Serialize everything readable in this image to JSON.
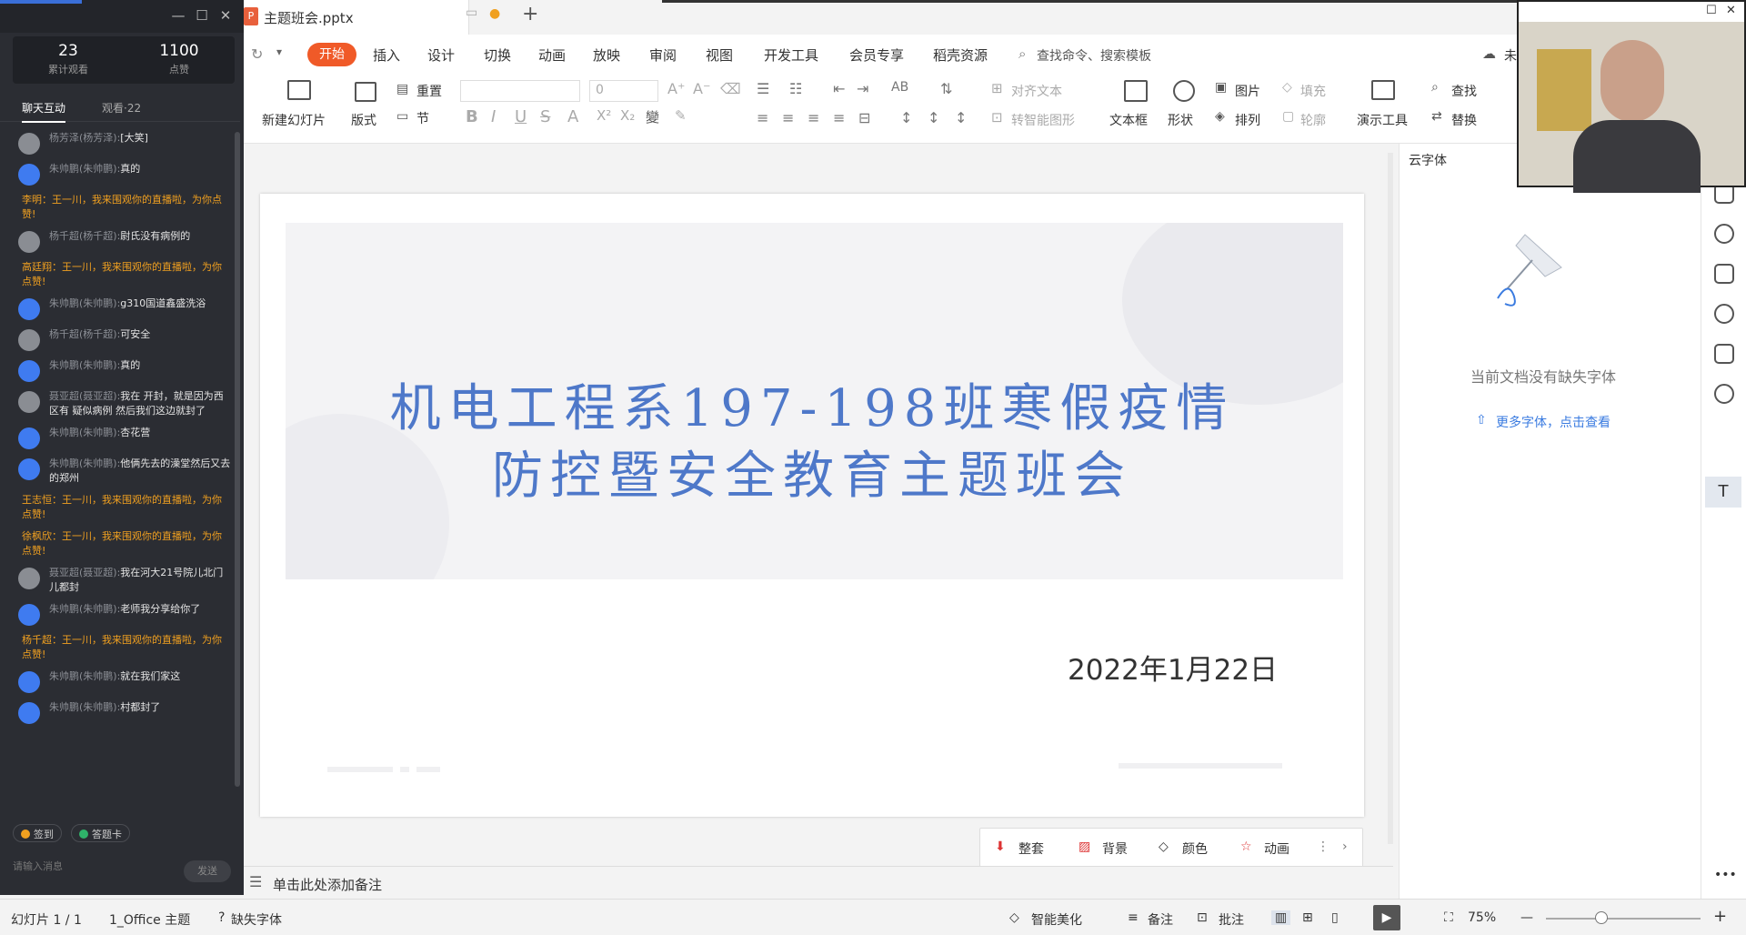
{
  "live": {
    "stats": [
      {
        "num": "23",
        "label": "累计观看"
      },
      {
        "num": "1100",
        "label": "点赞"
      }
    ],
    "tab_chat": "聊天互动",
    "tab_viewers": "观看·22",
    "messages": [
      {
        "kind": "user",
        "avatar": "gray",
        "name": "杨芳泽(杨芳泽):",
        "text": "[大笑]"
      },
      {
        "kind": "user",
        "avatar": "blue",
        "name": "朱帅鹏(朱帅鹏):",
        "text": "真的"
      },
      {
        "kind": "sys",
        "text": "李明：王一川，我来围观你的直播啦，为你点赞!"
      },
      {
        "kind": "user",
        "avatar": "gray",
        "name": "杨千超(杨千超):",
        "text": "尉氏没有病例的"
      },
      {
        "kind": "sys",
        "text": "高廷翔：王一川，我来围观你的直播啦，为你点赞!"
      },
      {
        "kind": "user",
        "avatar": "blue",
        "name": "朱帅鹏(朱帅鹏):",
        "text": "g310国道鑫盛洗浴"
      },
      {
        "kind": "user",
        "avatar": "gray",
        "name": "杨千超(杨千超):",
        "text": "可安全"
      },
      {
        "kind": "user",
        "avatar": "blue",
        "name": "朱帅鹏(朱帅鹏):",
        "text": "真的"
      },
      {
        "kind": "user",
        "avatar": "gray",
        "name": "聂亚超(聂亚超):",
        "text": "我在 开封，就是因为西区有 疑似病例 然后我们这边就封了"
      },
      {
        "kind": "user",
        "avatar": "blue",
        "name": "朱帅鹏(朱帅鹏):",
        "text": "杏花营"
      },
      {
        "kind": "user",
        "avatar": "blue",
        "name": "朱帅鹏(朱帅鹏):",
        "text": "他俩先去的澡堂然后又去的郑州"
      },
      {
        "kind": "sys",
        "text": "王志恒：王一川，我来围观你的直播啦，为你点赞!"
      },
      {
        "kind": "sys",
        "text": "徐枫欣：王一川，我来围观你的直播啦，为你点赞!"
      },
      {
        "kind": "user",
        "avatar": "gray",
        "name": "聂亚超(聂亚超):",
        "text": "我在河大21号院儿北门儿都封"
      },
      {
        "kind": "user",
        "avatar": "blue",
        "name": "朱帅鹏(朱帅鹏):",
        "text": "老师我分享给你了"
      },
      {
        "kind": "sys",
        "text": "杨千超：王一川，我来围观你的直播啦，为你点赞!"
      },
      {
        "kind": "user",
        "avatar": "blue",
        "name": "朱帅鹏(朱帅鹏):",
        "text": "就在我们家这"
      },
      {
        "kind": "user",
        "avatar": "blue",
        "name": "朱帅鹏(朱帅鹏):",
        "text": "村都封了"
      }
    ],
    "checkin": "签到",
    "answer_card": "答题卡",
    "input_placeholder": "请输入消息",
    "send": "发送"
  },
  "doc": {
    "filename": "主题班会.pptx",
    "new_tab": "+"
  },
  "menu": {
    "items": [
      "开始",
      "插入",
      "设计",
      "切换",
      "动画",
      "放映",
      "审阅",
      "视图",
      "开发工具",
      "会员专享",
      "稻壳资源"
    ],
    "search": "查找命令、搜索模板",
    "cloud": "未"
  },
  "ribbon": {
    "new_slide": "新建幻灯片",
    "layout": "版式",
    "reset": "重置",
    "section": "节",
    "font_size": "0",
    "align_text": "对齐文本",
    "smart_art": "转智能图形",
    "textbox": "文本框",
    "shape": "形状",
    "picture": "图片",
    "fill": "填充",
    "arrange": "排列",
    "outline": "轮廓",
    "present_tools": "演示工具",
    "find": "查找",
    "replace": "替换"
  },
  "slide": {
    "title_line1": "机电工程系197-198班寒假疫情",
    "title_line2": "防控暨安全教育主题班会",
    "date": "2022年1月22日"
  },
  "floatbar": {
    "items": [
      "整套",
      "背景",
      "颜色",
      "动画"
    ]
  },
  "notes": {
    "placeholder": "单击此处添加备注"
  },
  "rpanel": {
    "cloud_font": "云字体",
    "no_missing": "当前文档没有缺失字体",
    "more_fonts": "更多字体，点击查看"
  },
  "status": {
    "slide": "幻灯片 1 / 1",
    "theme": "1_Office 主题",
    "missing_font": "缺失字体",
    "beautify": "智能美化",
    "notes": "备注",
    "comment": "批注",
    "zoom": "75%"
  }
}
